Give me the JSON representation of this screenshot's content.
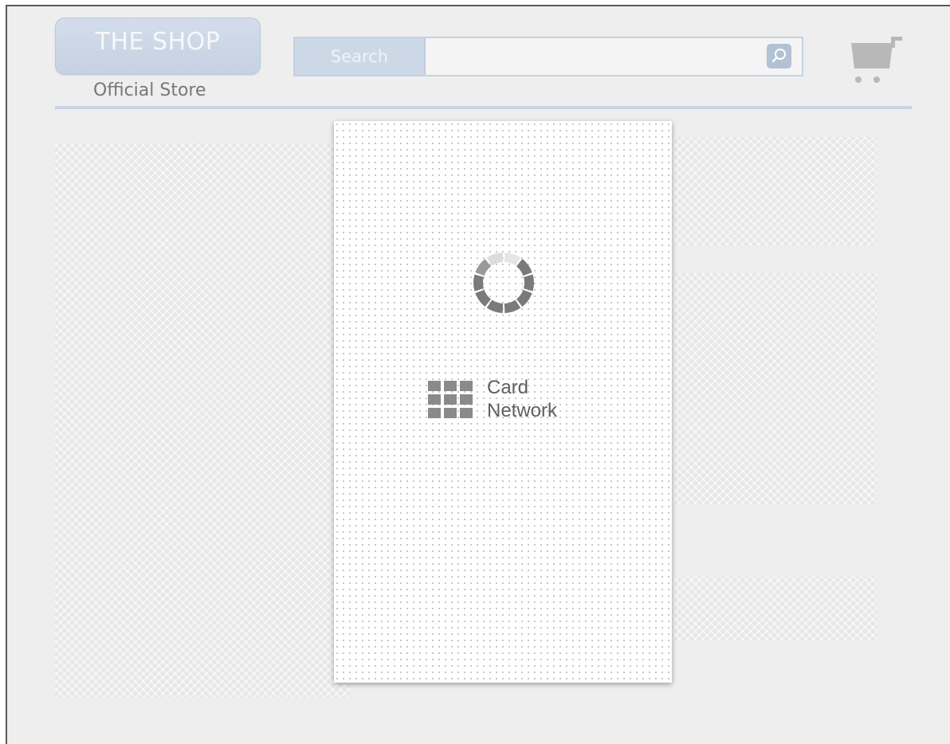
{
  "header": {
    "logo_text": "THE SHOP",
    "tagline": "Official Store",
    "search": {
      "label": "Search",
      "value": ""
    },
    "icons": {
      "search": "magnifier-icon",
      "cart": "shopping-cart-icon"
    }
  },
  "modal": {
    "status": "loading",
    "spinner_icon": "loading-spinner-icon",
    "brand": {
      "line1": "Card",
      "line2": "Network",
      "icon": "grid-logo-icon"
    }
  },
  "colors": {
    "accent": "#c6d2e2",
    "background": "#eeeeee",
    "spinner": "#7a7a7a",
    "brand_text": "#5f5f5f"
  }
}
